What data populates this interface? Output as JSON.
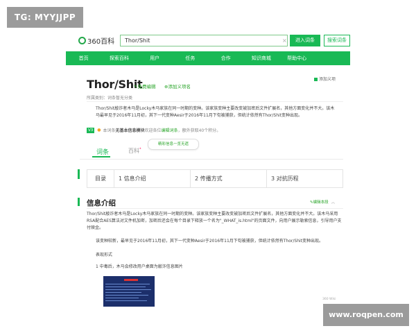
{
  "watermarks": {
    "top_left": "TG: MYYJJPP",
    "bottom_right": "www.roqpen.com"
  },
  "header": {
    "logo_text": "360百科",
    "search_value": "Thor/Shit",
    "clear_icon": "×",
    "enter_button": "进入词条",
    "search_button": "搜索词条"
  },
  "nav": {
    "items": [
      "首页",
      "探索百科",
      "用户",
      "任务",
      "合作",
      "知识商城",
      "帮助中心"
    ]
  },
  "entry": {
    "title": "Thor/Shit",
    "edit_link": "免费编辑",
    "add_link": "添加义项名",
    "add_mine": "添加义项",
    "category": "所属类别：词条暂无分类",
    "summary": "Thor/Shit敲诈者木马是Locky木马家族在同一时期的变种。该家族变种主要改变被加密后文件扩展名，其他方面变化并不大。该木马最早见于2016年11月初，其下一代变种Aesir于2016年11月下旬被捕获，但统计依然有Thor/Shit变种出现。",
    "meta_badge": "V3",
    "meta_prefix": "本词条",
    "meta_bold": "无基本信息模块",
    "meta_mid": "欢迎各位",
    "meta_link": "编辑词条",
    "meta_suffix": "，额外获取40个积分。"
  },
  "tabs": {
    "entry": "词条",
    "wiki": "百科",
    "wiki_badge": "*",
    "bubble": "精彩信息一览无遗"
  },
  "toc": {
    "head": "目录",
    "items": [
      "1 信息介绍",
      "2 传播方式",
      "3 对抗历程"
    ]
  },
  "info": {
    "title": "信息介绍",
    "edit": "编辑本段",
    "chevron": "︿",
    "p1": "Thor/Shit敲诈者木马是Locky木马家族在同一时期的变种。该家族变种主要改变被加密后文件扩展名，其他方面变化并不大。该木马采用RSA配合AES算法对文件机加密，加密后还会在每个目录下释放一个名为\"_WHAT_is.html\"的页面文件，向用户展示勒索信息，引导用户支付赎金。",
    "p2": "该变种较新，最早见于2016年11月初，其下一代变种Aesir于2016年11月下旬被捕获，但统计依然有Thor/Shit变种出现。",
    "p3": "表现形式",
    "p4": "1 中毒后，木马会修改用户桌面为敲诈信息图片",
    "credit": "360 Wiki"
  },
  "colors": {
    "brand_green": "#19b955",
    "link_green": "#2aa52a",
    "watermark_gray": "#9b9b9b"
  }
}
